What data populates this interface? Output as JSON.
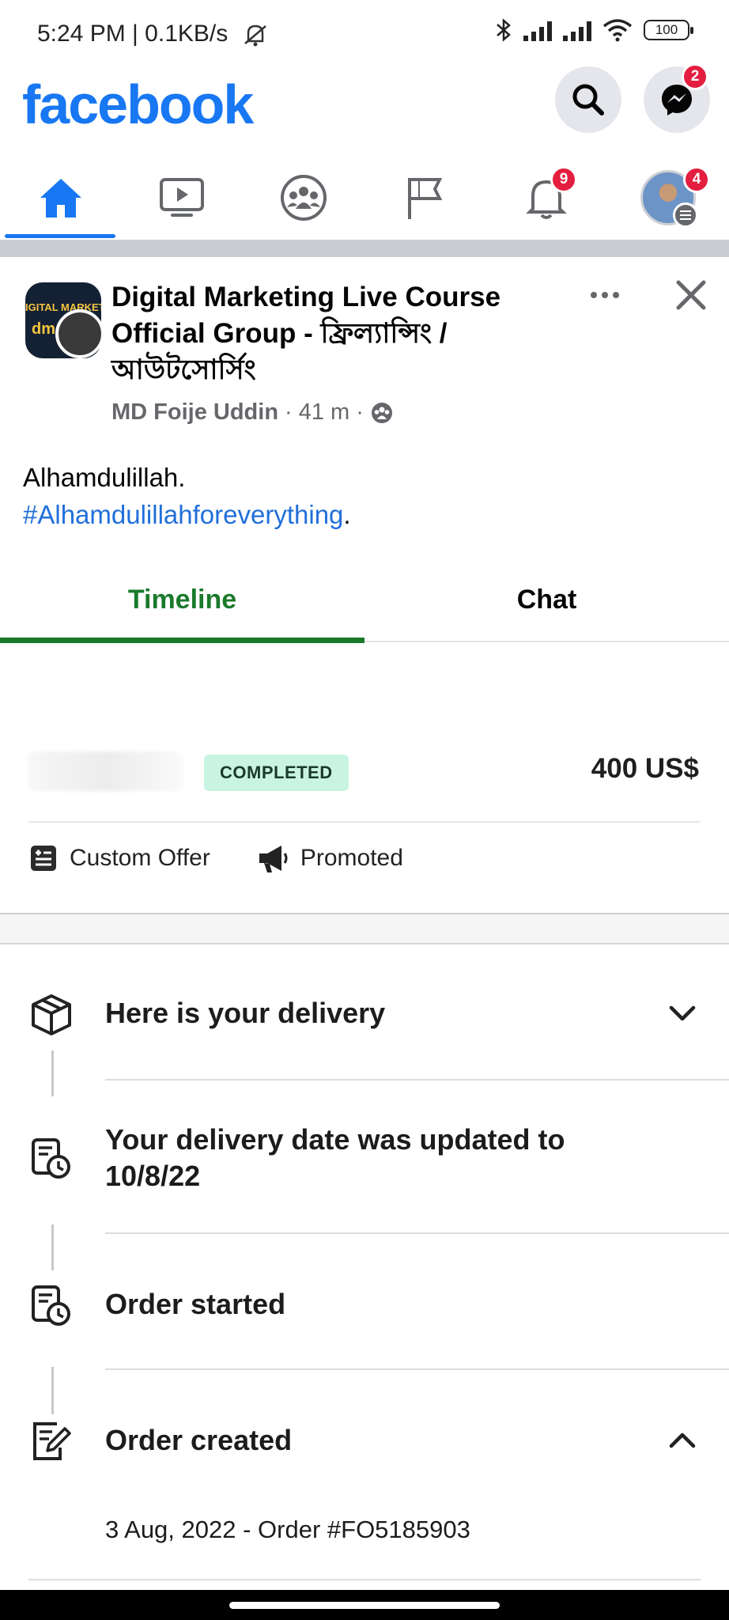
{
  "status_bar": {
    "time": "5:24 PM | 0.1KB/s",
    "battery": "100"
  },
  "header": {
    "logo": "facebook",
    "messenger_badge": "2"
  },
  "nav": {
    "notifications_badge": "9",
    "menu_badge": "4"
  },
  "post": {
    "group_name": "Digital Marketing Live Course Official Group - ফ্রিল্যান্সিং / আউটসোর্সিং",
    "avatar_text_top": "IGITAL MARKETING",
    "avatar_text_logo": "dm",
    "author": "MD Foije Uddin",
    "time_ago": "41 m",
    "text": "Alhamdulillah.",
    "hashtag": "#Alhamdulillahforeverything",
    "hashtag_suffix": "."
  },
  "order": {
    "tabs": [
      "Timeline",
      "Chat"
    ],
    "status": "COMPLETED",
    "price": "400 US$",
    "custom_offer_label": "Custom Offer",
    "promoted_label": "Promoted",
    "timeline": [
      {
        "title": "Here is your delivery"
      },
      {
        "title": "Your delivery date was updated to 10/8/22"
      },
      {
        "title": "Order started"
      },
      {
        "title": "Order created",
        "detail": "3 Aug, 2022 - Order #FO5185903"
      }
    ]
  }
}
